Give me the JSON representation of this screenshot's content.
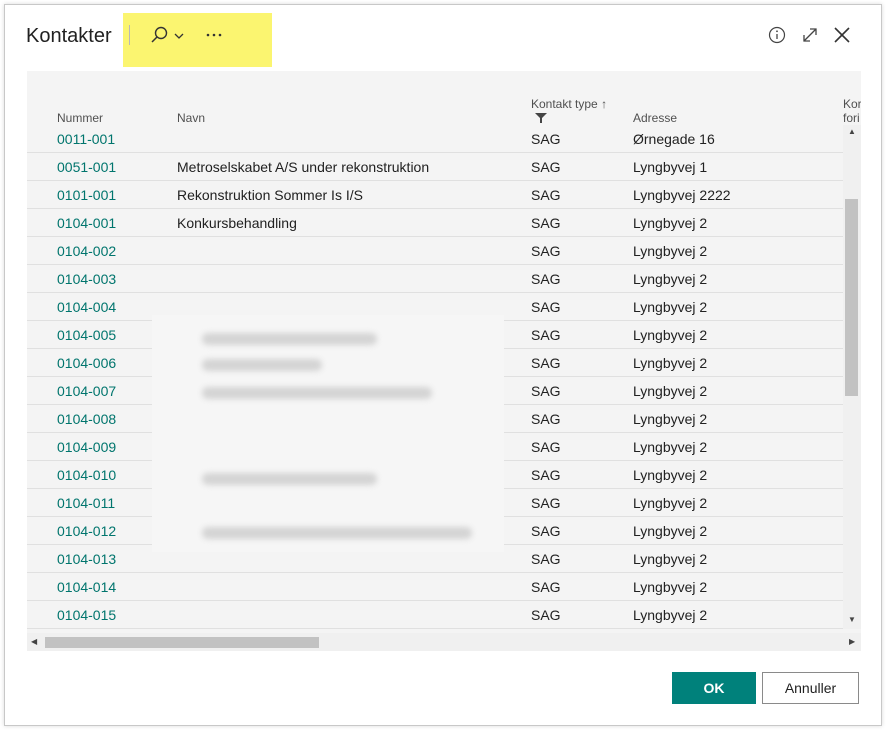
{
  "window": {
    "title": "Kontakter"
  },
  "toolbar": {
    "search_icon": "search-icon",
    "more_label": "···"
  },
  "header_icons": [
    "info-icon",
    "expand-icon",
    "close-icon"
  ],
  "columns": {
    "number": "Nummer",
    "name": "Navn",
    "type": "Kontakt type",
    "type_sort": "↑",
    "address": "Adresse",
    "next_line1": "Kor",
    "next_line2": "fori"
  },
  "rows": [
    {
      "number": "0011-001",
      "name": "",
      "type": "SAG",
      "address": "Ørnegade 16"
    },
    {
      "number": "0051-001",
      "name": "Metroselskabet A/S under rekonstruktion",
      "type": "SAG",
      "address": "Lyngbyvej 1"
    },
    {
      "number": "0101-001",
      "name": "Rekonstruktion Sommer Is I/S",
      "type": "SAG",
      "address": "Lyngbyvej 2222"
    },
    {
      "number": "0104-001",
      "name": "Konkursbehandling",
      "type": "SAG",
      "address": "Lyngbyvej 2"
    },
    {
      "number": "0104-002",
      "name": "",
      "type": "SAG",
      "address": "Lyngbyvej 2"
    },
    {
      "number": "0104-003",
      "name": "",
      "type": "SAG",
      "address": "Lyngbyvej 2"
    },
    {
      "number": "0104-004",
      "name": "",
      "type": "SAG",
      "address": "Lyngbyvej 2"
    },
    {
      "number": "0104-005",
      "name": "",
      "type": "SAG",
      "address": "Lyngbyvej 2"
    },
    {
      "number": "0104-006",
      "name": "",
      "type": "SAG",
      "address": "Lyngbyvej 2"
    },
    {
      "number": "0104-007",
      "name": "",
      "type": "SAG",
      "address": "Lyngbyvej 2"
    },
    {
      "number": "0104-008",
      "name": "",
      "type": "SAG",
      "address": "Lyngbyvej 2"
    },
    {
      "number": "0104-009",
      "name": "",
      "type": "SAG",
      "address": "Lyngbyvej 2"
    },
    {
      "number": "0104-010",
      "name": "",
      "type": "SAG",
      "address": "Lyngbyvej 2"
    },
    {
      "number": "0104-011",
      "name": "",
      "type": "SAG",
      "address": "Lyngbyvej 2"
    },
    {
      "number": "0104-012",
      "name": "",
      "type": "SAG",
      "address": "Lyngbyvej 2"
    },
    {
      "number": "0104-013",
      "name": "",
      "type": "SAG",
      "address": "Lyngbyvej 2"
    },
    {
      "number": "0104-014",
      "name": "",
      "type": "SAG",
      "address": "Lyngbyvej 2"
    },
    {
      "number": "0104-015",
      "name": "",
      "type": "SAG",
      "address": "Lyngbyvej 2"
    }
  ],
  "footer": {
    "ok_label": "OK",
    "cancel_label": "Annuller"
  },
  "colors": {
    "accent": "#00817b",
    "link": "#00756d",
    "highlight": "#fbf570"
  }
}
